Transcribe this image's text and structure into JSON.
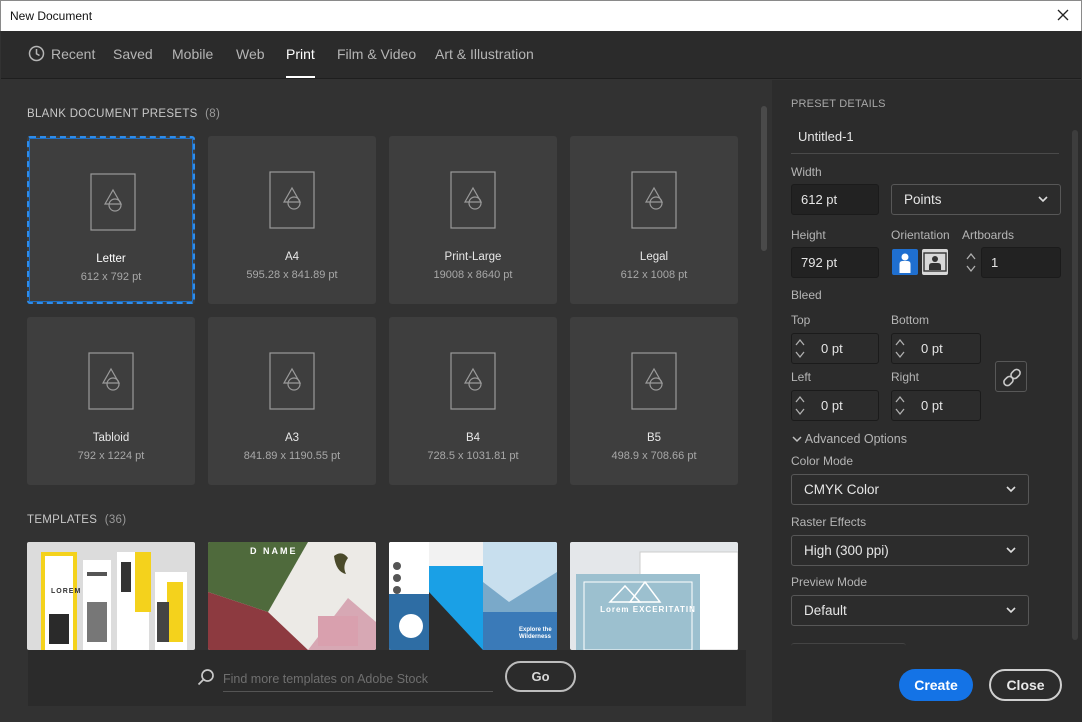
{
  "window": {
    "title": "New Document"
  },
  "tabs": [
    {
      "label": "Recent"
    },
    {
      "label": "Saved"
    },
    {
      "label": "Mobile"
    },
    {
      "label": "Web"
    },
    {
      "label": "Print"
    },
    {
      "label": "Film & Video"
    },
    {
      "label": "Art & Illustration"
    }
  ],
  "presets": {
    "heading": "BLANK DOCUMENT PRESETS",
    "count": "(8)",
    "items": [
      {
        "name": "Letter",
        "dims": "612 x 792 pt"
      },
      {
        "name": "A4",
        "dims": "595.28 x 841.89 pt"
      },
      {
        "name": "Print-Large",
        "dims": "19008 x 8640 pt"
      },
      {
        "name": "Legal",
        "dims": "612 x 1008 pt"
      },
      {
        "name": "Tabloid",
        "dims": "792 x 1224 pt"
      },
      {
        "name": "A3",
        "dims": "841.89 x 1190.55 pt"
      },
      {
        "name": "B4",
        "dims": "728.5 x 1031.81 pt"
      },
      {
        "name": "B5",
        "dims": "498.9 x 708.66 pt"
      }
    ]
  },
  "templates": {
    "heading": "TEMPLATES",
    "count": "(36)",
    "items": [
      {
        "text": "LOREM"
      },
      {
        "text": "D NAME"
      },
      {
        "text": "Explore the Wilderness"
      },
      {
        "text": "Lorem EXCERITATIN"
      }
    ]
  },
  "search": {
    "placeholder": "Find more templates on Adobe Stock",
    "go": "Go"
  },
  "details": {
    "heading": "PRESET DETAILS",
    "doc_name": "Untitled-1",
    "width_label": "Width",
    "width_value": "612 pt",
    "units": "Points",
    "height_label": "Height",
    "height_value": "792 pt",
    "orientation_label": "Orientation",
    "artboards_label": "Artboards",
    "artboards_value": "1",
    "bleed_label": "Bleed",
    "top_label": "Top",
    "top_value": "0 pt",
    "bottom_label": "Bottom",
    "bottom_value": "0 pt",
    "left_label": "Left",
    "left_value": "0 pt",
    "right_label": "Right",
    "right_value": "0 pt",
    "advanced": "Advanced Options",
    "color_mode_label": "Color Mode",
    "color_mode_value": "CMYK Color",
    "raster_label": "Raster Effects",
    "raster_value": "High (300 ppi)",
    "preview_label": "Preview Mode",
    "preview_value": "Default"
  },
  "actions": {
    "create": "Create",
    "close": "Close"
  },
  "colors": {
    "accent": "#1473e6",
    "selection": "#2d8ceb"
  }
}
